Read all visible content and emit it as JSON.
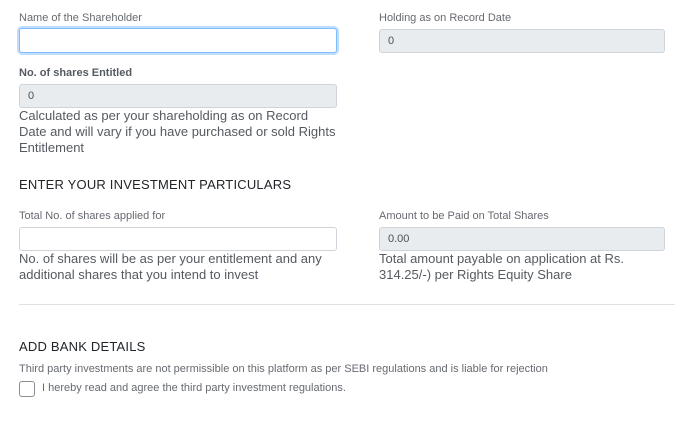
{
  "shareholder": {
    "name_label": "Name of the Shareholder",
    "name_value": "",
    "holding_label": "Holding as on Record Date",
    "holding_value": "0",
    "entitled_label": "No. of shares Entitled",
    "entitled_value": "0",
    "entitled_help": "Calculated as per your shareholding as on Record Date and will vary if you have purchased or sold Rights Entitlement"
  },
  "investment": {
    "heading": "ENTER YOUR INVESTMENT PARTICULARS",
    "shares_label": "Total No. of shares applied for",
    "shares_value": "",
    "shares_help": "No. of shares will be as per your entitlement and any additional shares that you intend to invest",
    "amount_label": "Amount to be Paid on Total Shares",
    "amount_value": "0.00",
    "amount_help": "Total amount payable on application at Rs. 314.25/-) per Rights Equity Share"
  },
  "bank": {
    "heading": "ADD BANK DETAILS",
    "notice": "Third party investments are not permissible on this platform as per SEBI regulations and is liable for rejection",
    "agree_label": "I hereby read and agree the third party investment regulations.",
    "agree_checked": false
  }
}
